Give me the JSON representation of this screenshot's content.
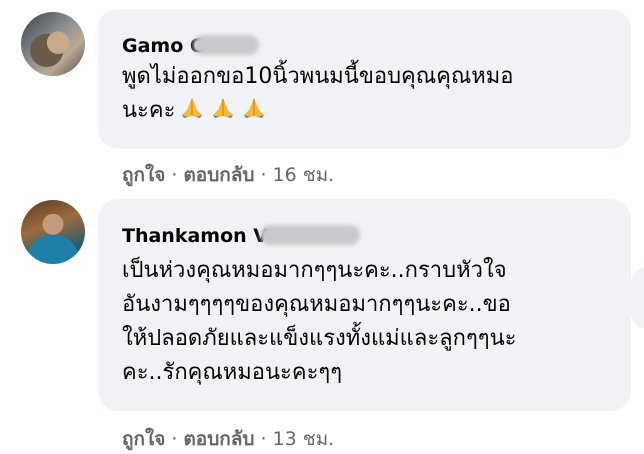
{
  "comments": [
    {
      "author": "Gamo C",
      "text": "พูดไม่ออกขอ10นิ้วพนมนี้ขอบคุณคุณหมอ\nนะคะ",
      "reaction_icons": [
        "folded-hands-icon",
        "folded-hands-icon",
        "folded-hands-icon"
      ],
      "like_label": "ถูกใจ",
      "reply_label": "ตอบกลับ",
      "separator": "·",
      "time": "16 ชม."
    },
    {
      "author": "Thankamon V",
      "text": "เป็นห่วงคุณหมอมากๆๆนะคะ..กราบหัวใจ\nอันงามๆๆๆๆของคุณหมอมากๆๆนะคะ..ขอ\nให้ปลอดภัยและแข็งแรงทั้งแม่และลูกๆๆนะ\nคะ..รักคุณหมอนะคะๆๆ",
      "like_label": "ถูกใจ",
      "reply_label": "ตอบกลับ",
      "separator": "·",
      "time": "13 ชม."
    }
  ],
  "colors": {
    "bubble": "#f0f2f5",
    "meta_text": "#65676b",
    "text": "#050505"
  }
}
